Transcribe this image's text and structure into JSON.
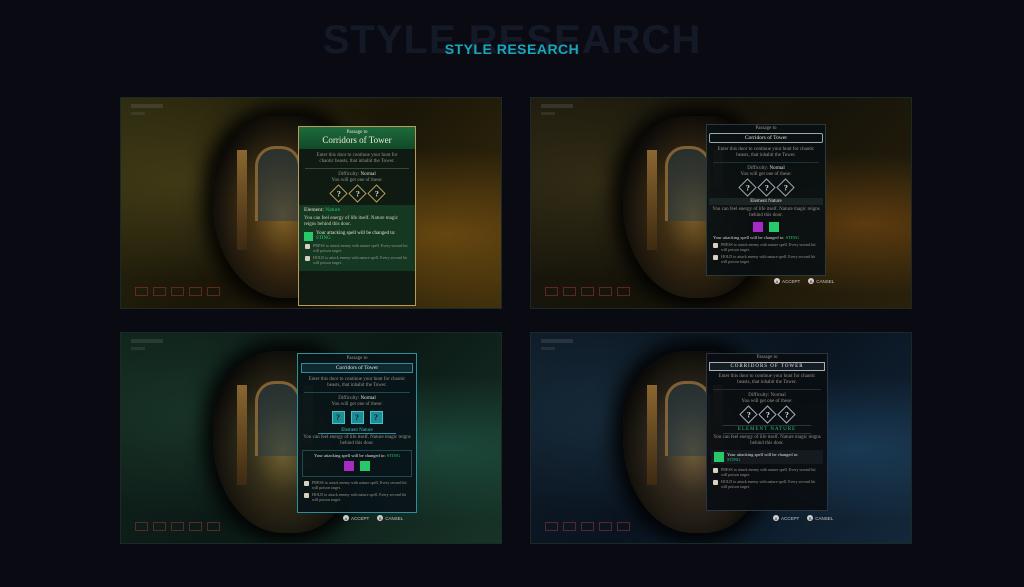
{
  "page": {
    "superscript": "",
    "background_title": "STYLE RESEARCH",
    "title": "STYLE RESEARCH",
    "accent": "#18a6b8"
  },
  "dialog": {
    "subtitle": "Passage to",
    "title": "Corridors of Tower",
    "title_caps": "CORRIDORS OF TOWER",
    "intro": "Enter this door to continue your hunt for chaotic beasts, that inhabit the Tower.",
    "difficulty_label": "Difficulty:",
    "difficulty_value": "Normal",
    "reward_text": "You will get one of these:",
    "question_mark": "?",
    "element_label": "Element:",
    "element_value": "Nature",
    "element_heading": "Element Nature",
    "element_heading_caps": "ELEMENT NATURE",
    "element_desc": "You can feel energy of life itself. Nature magic reigns behind this door.",
    "spell_text": "Your attacking spell will be changed to:",
    "spell_name": "STING",
    "info_1": "PRESS to attack enemy with nature spell. Every second hit will poison target.",
    "info_2": "HOLD to attack enemy with nature spell. Every second hit will poison target.",
    "accept": "ACCEPT",
    "cancel": "CANSEL"
  },
  "colors": {
    "nature_green": "#27c96a",
    "panel_green_bg": "#0f2a1b",
    "panel_dark_bg": "#0d1316",
    "teal_frame": "#2e8f9a",
    "gold_frame": "#b89a5a"
  }
}
